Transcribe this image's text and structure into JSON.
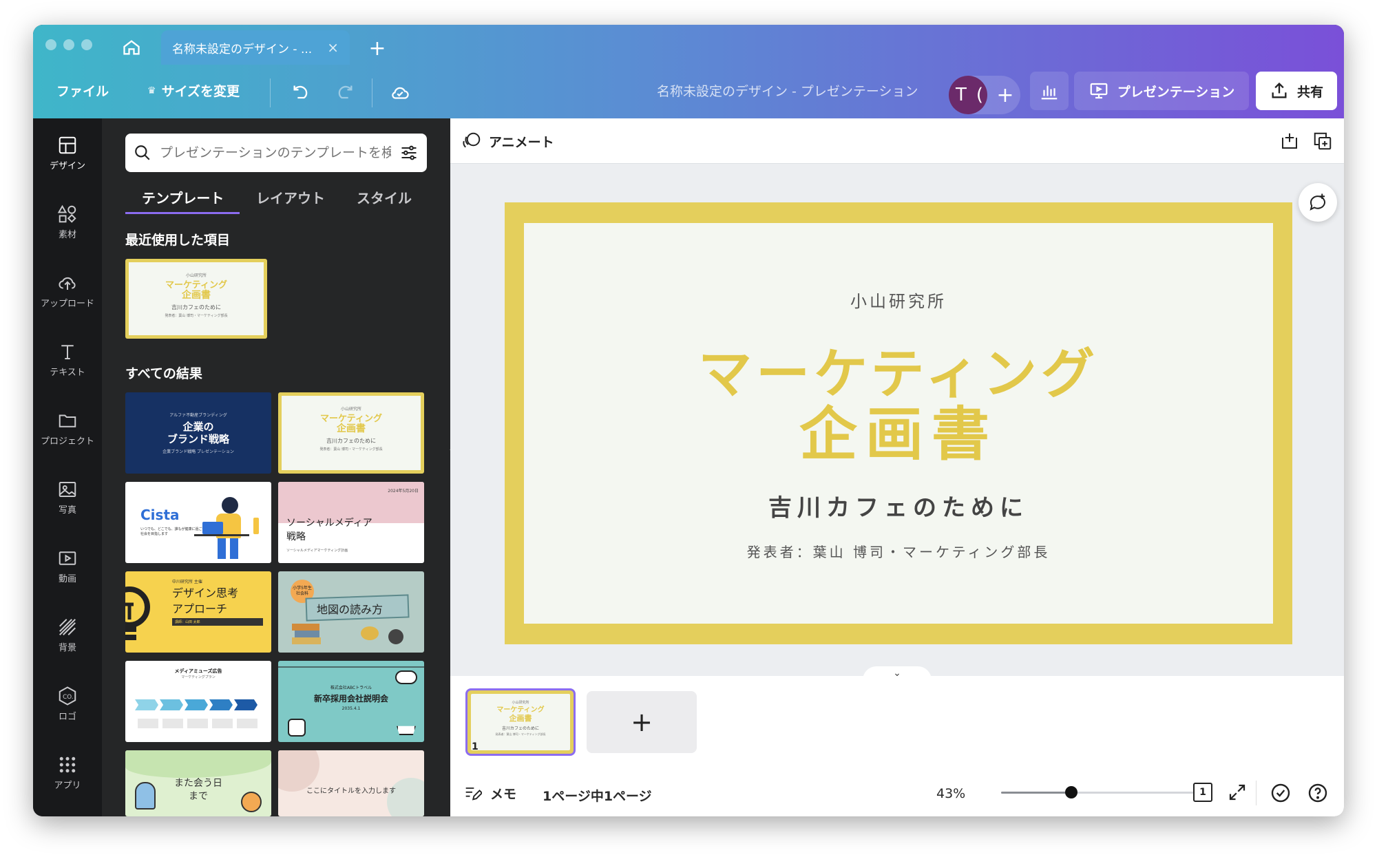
{
  "window": {
    "tab_title": "名称未設定のデザイン - ...",
    "doc_title": "名称未設定のデザイン - プレゼンテーション"
  },
  "toolbar": {
    "file": "ファイル",
    "resize": "サイズを変更",
    "avatar_initial": "T",
    "avatar_extra": "(",
    "present": "プレゼンテーション",
    "share": "共有"
  },
  "rail": [
    {
      "label": "デザイン",
      "icon": "design-icon"
    },
    {
      "label": "素材",
      "icon": "elements-icon"
    },
    {
      "label": "アップロード",
      "icon": "upload-icon"
    },
    {
      "label": "テキスト",
      "icon": "text-icon"
    },
    {
      "label": "プロジェクト",
      "icon": "folder-icon"
    },
    {
      "label": "写真",
      "icon": "photo-icon"
    },
    {
      "label": "動画",
      "icon": "video-icon"
    },
    {
      "label": "背景",
      "icon": "background-icon"
    },
    {
      "label": "ロゴ",
      "icon": "logo-icon"
    },
    {
      "label": "アプリ",
      "icon": "apps-icon"
    }
  ],
  "panel": {
    "search_placeholder": "プレゼンテーションのテンプレートを検索",
    "tabs": [
      "テンプレート",
      "レイアウト",
      "スタイル"
    ],
    "recent_title": "最近使用した項目",
    "all_title": "すべての結果",
    "recent_thumb": {
      "top": "小山研究所",
      "title1": "マーケティング",
      "title2": "企画書",
      "sub": "吉川カフェのために",
      "foot": "発表者：葉山 博司・マーケティング部長"
    },
    "thumbs": {
      "t1_small": "アルファ不動産ブランディング",
      "t1_title1": "企業の",
      "t1_title2": "ブランド戦略",
      "t1_sub": "企業ブランド戦略 プレゼンテーション",
      "t3_title": "Cista",
      "t3_text": "いつでも、どこでも、誰もが健康に過ごせる社会を目指します",
      "t4_date": "2024年5月20日",
      "t4_title1": "ソーシャルメディア",
      "t4_title2": "戦略",
      "t4_sub": "ソーシャルメディアマーケティング計画",
      "t5_small": "中川研究所 主催",
      "t5_title1": "デザイン思考",
      "t5_title2": "アプローチ",
      "t5_bar": "講師：山田 太郎",
      "t6_badge": "小学5年生 社会科",
      "t6_title": "地図の読み方",
      "t7_title": "メディアミューズ広告",
      "t7_sub": "マーケティングプラン",
      "t8_small": "株式会社ABCトラベル",
      "t8_title": "新卒採用会社説明会",
      "t8_date": "2035.4.1",
      "t9_title1": "また会う日",
      "t9_title2": "まで",
      "t10_title": "ここにタイトルを入力します"
    }
  },
  "canvas": {
    "animate": "アニメート",
    "slide": {
      "org": "小山研究所",
      "title1": "マーケティング",
      "title2": "企画書",
      "subtitle": "吉川カフェのために",
      "presenter": "発表者：葉山 博司・マーケティング部長"
    },
    "page_number": "1",
    "notes": "メモ",
    "page_status": "1ページ中1ページ",
    "zoom": "43%",
    "zoom_level": 0.43,
    "page_count_badge": "1"
  },
  "colors": {
    "slide_yellow": "#e4cf5c",
    "slide_bg": "#f4f7f1",
    "title_yellow": "#e2c84a",
    "accent_purple": "#7a50d8"
  }
}
